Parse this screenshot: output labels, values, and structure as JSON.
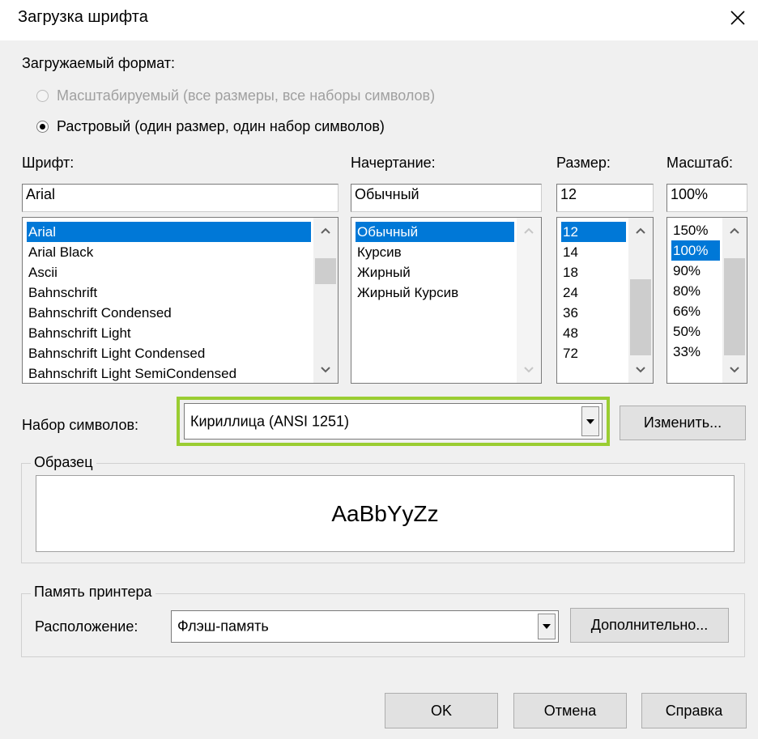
{
  "window": {
    "title": "Загрузка шрифта"
  },
  "format": {
    "label": "Загружаемый формат:",
    "options": [
      {
        "label": "Масштабируемый (все размеры, все наборы символов)",
        "selected": false,
        "disabled": true
      },
      {
        "label": "Растровый (один размер, один набор символов)",
        "selected": true,
        "disabled": false
      }
    ]
  },
  "font": {
    "label": "Шрифт:",
    "value": "Arial",
    "items": [
      "Arial",
      "Arial Black",
      "Ascii",
      "Bahnschrift",
      "Bahnschrift Condensed",
      "Bahnschrift Light",
      "Bahnschrift Light Condensed",
      "Bahnschrift Light SemiCondensed"
    ],
    "selected": "Arial"
  },
  "style": {
    "label": "Начертание:",
    "value": "Обычный",
    "items": [
      "Обычный",
      "Курсив",
      "Жирный",
      "Жирный Курсив"
    ],
    "selected": "Обычный"
  },
  "size": {
    "label": "Размер:",
    "value": "12",
    "items": [
      "12",
      "14",
      "18",
      "24",
      "36",
      "48",
      "72"
    ],
    "selected": "12"
  },
  "scale": {
    "label": "Масштаб:",
    "value": "100%",
    "items": [
      "150%",
      "100%",
      "90%",
      "80%",
      "66%",
      "50%",
      "33%"
    ],
    "selected": "100%"
  },
  "charset": {
    "label": "Набор символов:",
    "value": "Кириллица (ANSI 1251)",
    "change_button": "Изменить...",
    "highlight_color": "#9acd32"
  },
  "sample": {
    "title": "Образец",
    "text": "AaBbYyZz"
  },
  "printer_memory": {
    "title": "Память принтера",
    "location_label": "Расположение:",
    "location_value": "Флэш-память",
    "more_button": "Дополнительно..."
  },
  "footer": {
    "ok": "OK",
    "cancel": "Отмена",
    "help": "Справка"
  },
  "colors": {
    "selection": "#0078d7",
    "disabled_text": "#a0a0a0"
  },
  "icons": [
    "close-icon",
    "radio-icon",
    "arrow-up-icon",
    "arrow-down-icon",
    "dropdown-arrow-icon"
  ]
}
